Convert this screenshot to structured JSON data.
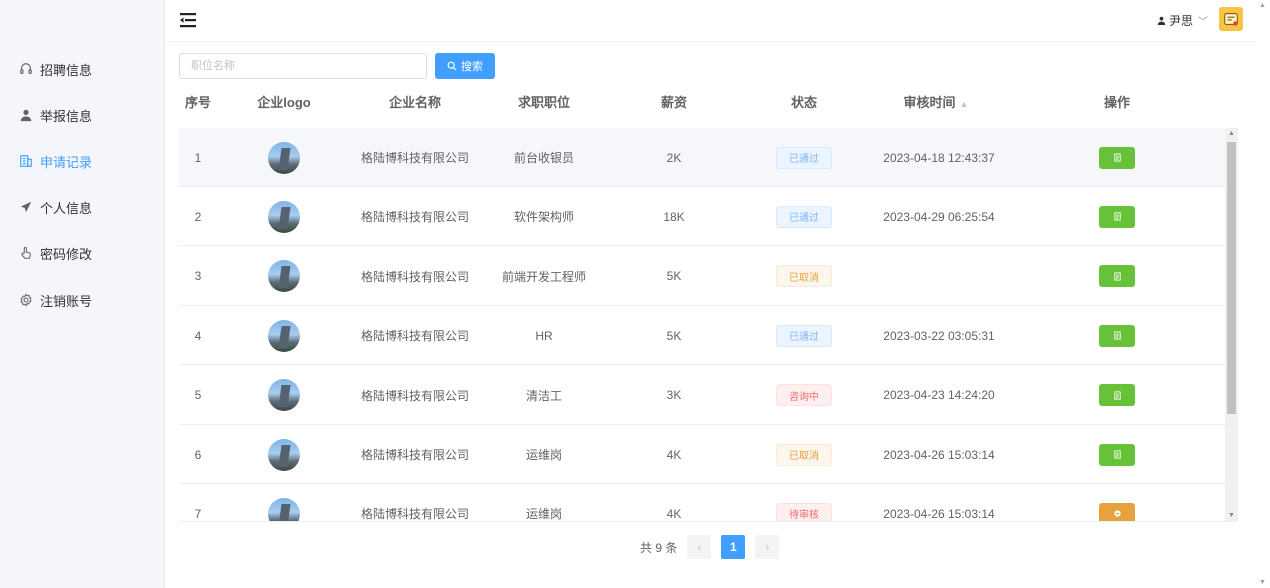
{
  "sidebar": {
    "items": [
      {
        "label": "招聘信息",
        "icon": "headset-icon"
      },
      {
        "label": "举报信息",
        "icon": "user-icon"
      },
      {
        "label": "申请记录",
        "icon": "building-icon",
        "active": true
      },
      {
        "label": "个人信息",
        "icon": "send-icon"
      },
      {
        "label": "密码修改",
        "icon": "pointer-icon"
      },
      {
        "label": "注销账号",
        "icon": "gear-icon"
      }
    ]
  },
  "header": {
    "user_name": "尹思",
    "menu_icon": "fold-menu-icon"
  },
  "search": {
    "placeholder": "职位名称",
    "value": "",
    "button_label": "搜索"
  },
  "table": {
    "columns": [
      "序号",
      "企业logo",
      "企业名称",
      "求职职位",
      "薪资",
      "状态",
      "审核时间",
      "操作"
    ],
    "rows": [
      {
        "index": "1",
        "company": "格陆博科技有限公司",
        "position": "前台收银员",
        "salary": "2K",
        "status": "已通过",
        "status_type": "pass",
        "time": "2023-04-18 12:43:37",
        "action": "green"
      },
      {
        "index": "2",
        "company": "格陆博科技有限公司",
        "position": "软件架构师",
        "salary": "18K",
        "status": "已通过",
        "status_type": "pass",
        "time": "2023-04-29 06:25:54",
        "action": "green"
      },
      {
        "index": "3",
        "company": "格陆博科技有限公司",
        "position": "前端开发工程师",
        "salary": "5K",
        "status": "已取消",
        "status_type": "cancel",
        "time": "",
        "action": "green"
      },
      {
        "index": "4",
        "company": "格陆博科技有限公司",
        "position": "HR",
        "salary": "5K",
        "status": "已通过",
        "status_type": "pass",
        "time": "2023-03-22 03:05:31",
        "action": "green"
      },
      {
        "index": "5",
        "company": "格陆博科技有限公司",
        "position": "清洁工",
        "salary": "3K",
        "status": "咨询中",
        "status_type": "consult",
        "time": "2023-04-23 14:24:20",
        "action": "green"
      },
      {
        "index": "6",
        "company": "格陆博科技有限公司",
        "position": "运维岗",
        "salary": "4K",
        "status": "已取消",
        "status_type": "cancel",
        "time": "2023-04-26 15:03:14",
        "action": "green"
      },
      {
        "index": "7",
        "company": "格陆博科技有限公司",
        "position": "运维岗",
        "salary": "4K",
        "status": "待审核",
        "status_type": "pending",
        "time": "2023-04-26 15:03:14",
        "action": "orange"
      }
    ]
  },
  "pagination": {
    "total_label": "共 9 条",
    "current_page": "1"
  },
  "colors": {
    "accent": "#409eff",
    "success": "#67c23a",
    "warning": "#e6a23c"
  }
}
